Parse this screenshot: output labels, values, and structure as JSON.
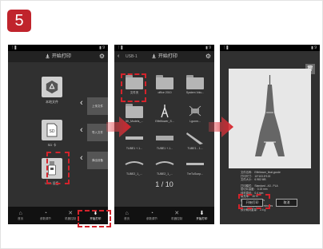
{
  "step_number": "5",
  "colors": {
    "accent": "#d4232b",
    "badge": "#c0242c",
    "phone_bg": "#303030"
  },
  "phone1": {
    "status_left": "ᛚ ▋",
    "status_right": "▮ 9",
    "title": "开始打印",
    "sources": [
      {
        "label": "本地文件",
        "icon": "local-files-icon"
      },
      {
        "label": "SD 卡",
        "icon": "sd-card-icon"
      },
      {
        "label": "USB 设备",
        "icon": "usb-icon"
      }
    ],
    "side_buttons": [
      "上传文件",
      "导入文件",
      "弹出设备"
    ],
    "nav": [
      {
        "label": "首页",
        "icon": "home-icon"
      },
      {
        "label": "参数调节",
        "icon": "tune-icon"
      },
      {
        "label": "机器控制",
        "icon": "tools-icon"
      },
      {
        "label": "开始打印",
        "icon": "print-icon"
      }
    ]
  },
  "phone2": {
    "status_left": "ᛚ ▋",
    "status_right": "▮ 9",
    "title": "开始打印",
    "crumb": "USB-1",
    "items": [
      {
        "label": "文件夹"
      },
      {
        "label": "office 2010"
      },
      {
        "label": "System Volu..."
      },
      {
        "label": "3D_Models_..."
      },
      {
        "label": "Effelltower_S..."
      },
      {
        "label": "Lgunm..."
      },
      {
        "label": "TUBE1 +.1..."
      },
      {
        "label": "TUBE1 +.1..."
      },
      {
        "label": "TUBE1 - 1..."
      },
      {
        "label": "TUBE2_1_..."
      },
      {
        "label": "TUBE2_1_..."
      },
      {
        "label": "TreTuSunp..."
      }
    ],
    "pager": "1 / 10",
    "nav": [
      {
        "label": "首页",
        "icon": "home-icon"
      },
      {
        "label": "参数调节",
        "icon": "tune-icon"
      },
      {
        "label": "机器控制",
        "icon": "tools-icon"
      },
      {
        "label": "开始打印",
        "icon": "print-icon"
      }
    ]
  },
  "phone3": {
    "status_left": "ᛚ ▋",
    "status_right": "▮ 9",
    "meta": [
      "文件名称： Effeltower_final.gcode",
      "打印尺寸： 10*103.5*102",
      "文件大小： 6.982 MB",
      "",
      "打印模式： Standard - A3 - PLA",
      "层切片高度： 0.15 mm",
      "线材直径： 0.4 mm",
      "填充率： 15 %",
      "打印速度： 60 mm/s",
      "",
      "预计打印时间： 24 minutes",
      "预计耗材重量： 2.4 g"
    ],
    "print_label": "开始打印",
    "cancel_label": "取消"
  }
}
